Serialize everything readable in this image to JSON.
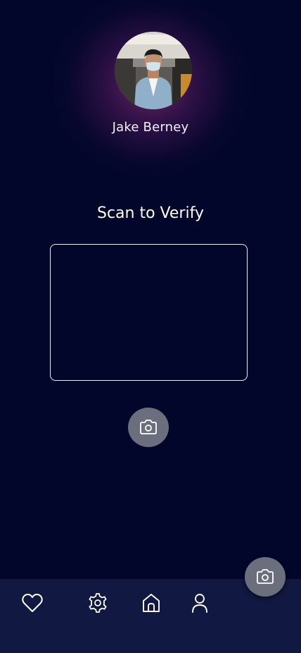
{
  "profile": {
    "name": "Jake Berney",
    "avatar_icon": "user-photo"
  },
  "scan": {
    "title": "Scan to Verify",
    "camera_icon": "camera-icon"
  },
  "fab": {
    "icon": "camera-icon"
  },
  "bottom_nav": {
    "items": [
      {
        "icon": "heart-icon"
      },
      {
        "icon": "gear-icon"
      },
      {
        "icon": "home-icon"
      },
      {
        "icon": "user-icon"
      }
    ]
  },
  "colors": {
    "background": "#01062a",
    "nav_background": "#111841",
    "button_gray": "#6b6e7d",
    "glow": "#78286e"
  }
}
